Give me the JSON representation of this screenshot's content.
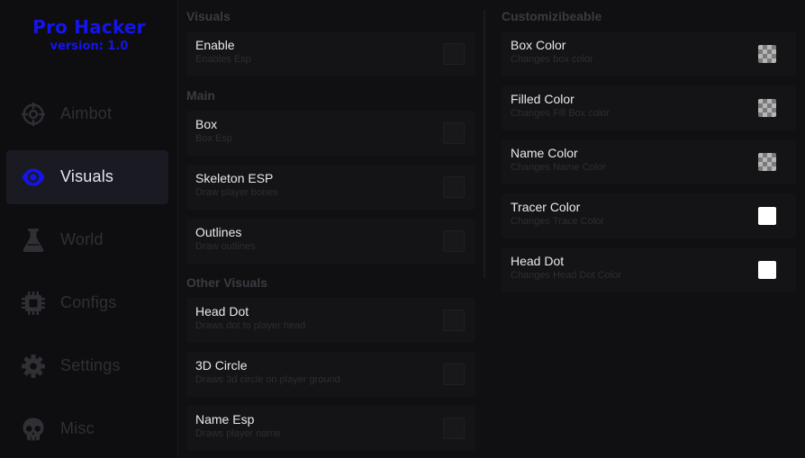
{
  "brand": {
    "title": "Pro Hacker",
    "version": "version: 1.0",
    "color": "#1414ee"
  },
  "sidebar": {
    "items": [
      {
        "label": "Aimbot",
        "icon": "crosshair-icon",
        "active": false
      },
      {
        "label": "Visuals",
        "icon": "eye-icon",
        "active": true
      },
      {
        "label": "World",
        "icon": "flask-icon",
        "active": false
      },
      {
        "label": "Configs",
        "icon": "chip-icon",
        "active": false
      },
      {
        "label": "Settings",
        "icon": "gear-icon",
        "active": false
      },
      {
        "label": "Misc",
        "icon": "skull-icon",
        "active": false
      }
    ]
  },
  "visuals": {
    "title": "Visuals",
    "enable": {
      "title": "Enable",
      "desc": "Enables Esp",
      "checked": false
    }
  },
  "main": {
    "title": "Main",
    "items": [
      {
        "title": "Box",
        "desc": "Box Esp",
        "checked": false
      },
      {
        "title": "Skeleton ESP",
        "desc": "Draw player bones",
        "checked": false
      },
      {
        "title": "Outlines",
        "desc": "Draw outlines",
        "checked": false
      }
    ]
  },
  "other": {
    "title": "Other Visuals",
    "items": [
      {
        "title": "Head Dot",
        "desc": "Draws dot to player head",
        "checked": false
      },
      {
        "title": "3D Circle",
        "desc": "Draws 3d circle on player ground",
        "checked": false
      },
      {
        "title": "Name Esp",
        "desc": "Draws player name",
        "checked": false
      }
    ]
  },
  "custom": {
    "title": "Customizibeable",
    "items": [
      {
        "title": "Box Color",
        "desc": "Changes box color",
        "swatch": "checker"
      },
      {
        "title": "Filled Color",
        "desc": "Changes Fill Box color",
        "swatch": "checker"
      },
      {
        "title": "Name Color",
        "desc": "Changes Name Color",
        "swatch": "checker"
      },
      {
        "title": "Tracer Color",
        "desc": "Changes Trace Color",
        "swatch": "#ffffff"
      },
      {
        "title": "Head Dot",
        "desc": "Changes Head Dot Color",
        "swatch": "#ffffff"
      }
    ]
  }
}
